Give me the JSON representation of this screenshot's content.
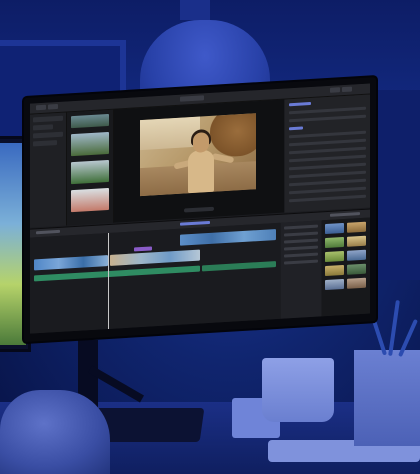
{
  "photo": {
    "subject": "",
    "application": ""
  },
  "colors": {
    "ambient_blue": "#1e3a9c",
    "screen_bg": "#1b1c20",
    "footage_tone": "#cbb58d",
    "timeline_clip": "#4f86c7",
    "audio_clip": "#2f8c62"
  },
  "icons": [
    "play-icon",
    "tools-icon"
  ]
}
